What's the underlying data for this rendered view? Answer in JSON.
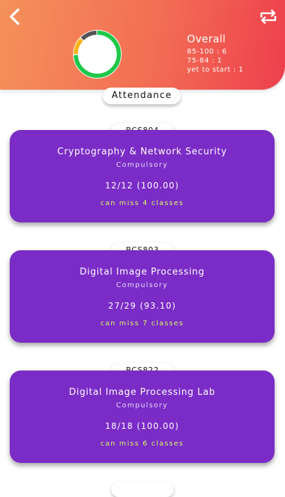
{
  "colors": {
    "header_gradient_start": "#f5915a",
    "header_gradient_end": "#ee3f4d",
    "card_purple": "#7b2cc6",
    "can_miss_text": "#d6ff66",
    "donut_green": "#1fc74a",
    "donut_yellow": "#f7b31b",
    "donut_gray": "#555555"
  },
  "header": {
    "back_icon": "chevron-left-icon",
    "refresh_icon": "refresh-icon"
  },
  "summary": {
    "title": "Overall",
    "lines": [
      "85-100 : 6",
      "75-84 : 1",
      "yet to start : 1"
    ],
    "donut": {
      "green": 6,
      "yellow": 1,
      "gray": 1
    }
  },
  "attendance_label": "Attendance",
  "courses": [
    {
      "code": "BCS804",
      "name": "Cryptography & Network Security",
      "type": "Compulsory",
      "stat": "12/12 (100.00)",
      "miss": "can miss 4 classes"
    },
    {
      "code": "BCS803",
      "name": "Digital Image Processing",
      "type": "Compulsory",
      "stat": "27/29 (93.10)",
      "miss": "can miss 7 classes"
    },
    {
      "code": "BCS822",
      "name": "Digital Image Processing Lab",
      "type": "Compulsory",
      "stat": "18/18 (100.00)",
      "miss": "can miss 6 classes"
    }
  ]
}
